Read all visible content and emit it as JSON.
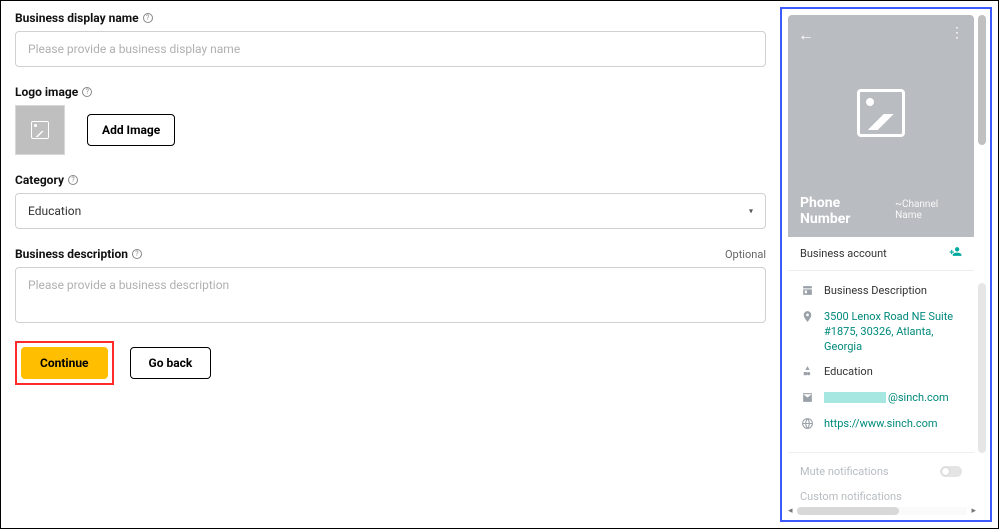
{
  "form": {
    "display_name": {
      "label": "Business display name",
      "placeholder": "Please provide a business display name"
    },
    "logo": {
      "label": "Logo image",
      "add_button": "Add Image"
    },
    "category": {
      "label": "Category",
      "value": "Education"
    },
    "description": {
      "label": "Business description",
      "placeholder": "Please provide a business description",
      "optional": "Optional"
    },
    "continue": "Continue",
    "go_back": "Go back"
  },
  "preview": {
    "phone_number": "Phone Number",
    "channel_name": "~Channel Name",
    "account_label": "Business account",
    "items": {
      "description": "Business Description",
      "address": "3500 Lenox Road NE Suite #1875, 30326, Atlanta, Georgia",
      "category": "Education",
      "email_domain": "@sinch.com",
      "website": "https://www.sinch.com"
    },
    "mute": "Mute notifications",
    "custom": "Custom notifications"
  }
}
